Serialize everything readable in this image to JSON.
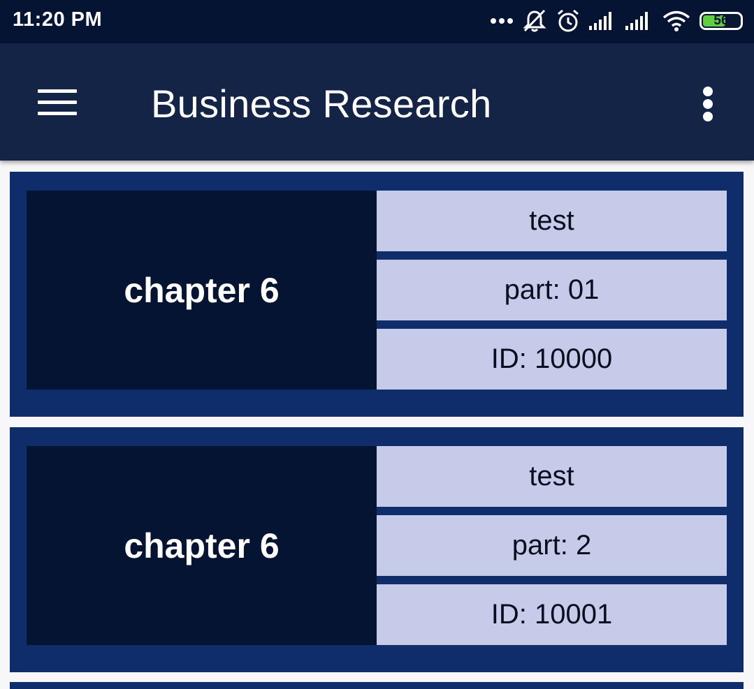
{
  "status_bar": {
    "time": "11:20 PM",
    "battery_level": "56",
    "icons": [
      "more-dots-icon",
      "vibrate-off-icon",
      "alarm-icon",
      "signal-icon",
      "signal-icon",
      "wifi-icon",
      "battery-icon"
    ]
  },
  "app_bar": {
    "title": "Business Research",
    "menu_icon": "hamburger-menu-icon",
    "overflow_icon": "more-vertical-icon"
  },
  "items": [
    {
      "chapter": "chapter 6",
      "name": "test",
      "part": "part: 01",
      "id": "ID: 10000"
    },
    {
      "chapter": "chapter 6",
      "name": "test",
      "part": "part: 2",
      "id": "ID: 10001"
    }
  ],
  "colors": {
    "status_bar": "#061433",
    "app_bar": "#142447",
    "card_border": "#0f2d6b",
    "chapter_box": "#051433",
    "info_cell": "#c5cbe9",
    "background": "#f7f7f9"
  }
}
